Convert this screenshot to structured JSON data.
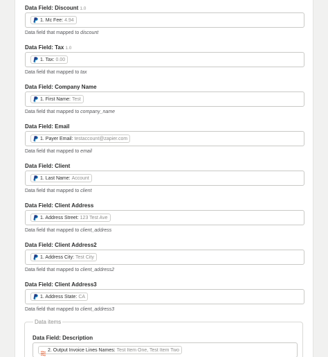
{
  "fields": [
    {
      "label": "Data Field: Discount",
      "version": "1.0",
      "pill_label": "1. Mc Fee:",
      "pill_value": "4.94",
      "help_prefix": "Data field that mapped to",
      "help_key": "discount"
    },
    {
      "label": "Data Field: Tax",
      "version": "1.0",
      "pill_label": "1. Tax:",
      "pill_value": "0.00",
      "help_prefix": "Data field that mapped to",
      "help_key": "tax"
    },
    {
      "label": "Data Field: Company Name",
      "version": "",
      "pill_label": "1. First Name:",
      "pill_value": "Test",
      "help_prefix": "Data field that mapped to",
      "help_key": "company_name"
    },
    {
      "label": "Data Field: Email",
      "version": "",
      "pill_label": "1. Payer Email:",
      "pill_value": "testaccount@zapier.com",
      "help_prefix": "Data field that mapped to",
      "help_key": "email"
    },
    {
      "label": "Data Field: Client",
      "version": "",
      "pill_label": "1. Last Name:",
      "pill_value": "Account",
      "help_prefix": "Data field that mapped to",
      "help_key": "client"
    },
    {
      "label": "Data Field: Client Address",
      "version": "",
      "pill_label": "1. Address Street:",
      "pill_value": "123 Test Ave",
      "help_prefix": "Data field that mapped to",
      "help_key": "client_address"
    },
    {
      "label": "Data Field: Client Address2",
      "version": "",
      "pill_label": "1. Address City:",
      "pill_value": "Test City",
      "help_prefix": "Data field that mapped to",
      "help_key": "client_address2"
    },
    {
      "label": "Data Field: Client Address3",
      "version": "",
      "pill_label": "1. Address State:",
      "pill_value": "CA",
      "help_prefix": "Data field that mapped to",
      "help_key": "client_address3"
    }
  ],
  "data_items": {
    "title": "Data items",
    "field": {
      "label": "Data Field: Description",
      "pill_label": "2. Output Invoice Lines Names:",
      "pill_value": "Test Item One, Test Item Two"
    }
  },
  "colors": {
    "paypal_dark": "#253b80",
    "paypal_light": "#179bd7",
    "lines_icon": "#e8734a"
  },
  "icons": {
    "paypal": "paypal-icon",
    "lines": "invoice-lines-icon"
  }
}
